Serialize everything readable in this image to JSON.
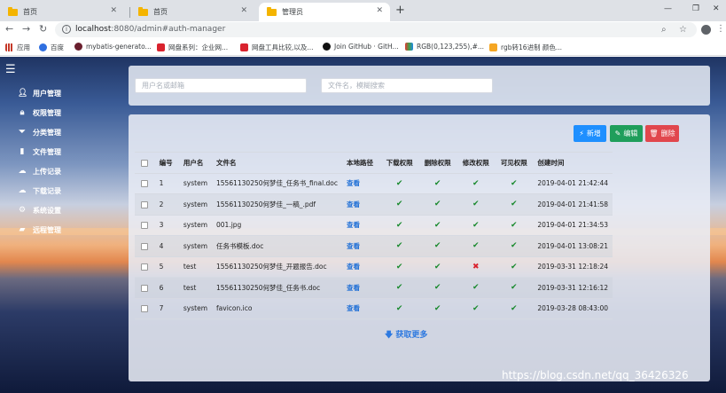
{
  "browser": {
    "tabs": [
      {
        "title": "首页"
      },
      {
        "title": "首页"
      },
      {
        "title": "管理员"
      }
    ],
    "url_host": "localhost",
    "url_path": ":8080/admin#auth-manager",
    "bookmarks": [
      "应用",
      "百度",
      "mybatis-generato...",
      "网盘系列：企业网...",
      "网盘工具比较,以及...",
      "Join GitHub · GitH...",
      "RGB(0,123,255),#...",
      "rgb转16进制 颜色..."
    ],
    "colors": {
      "tabstrip": "#dee1e6"
    }
  },
  "sidebar": {
    "items": [
      {
        "label": "用户管理",
        "icon": "user-icon"
      },
      {
        "label": "权限管理",
        "icon": "lock-icon"
      },
      {
        "label": "分类管理",
        "icon": "filter-icon"
      },
      {
        "label": "文件管理",
        "icon": "file-icon"
      },
      {
        "label": "上传记录",
        "icon": "cloud-upload-icon"
      },
      {
        "label": "下载记录",
        "icon": "cloud-download-icon"
      },
      {
        "label": "系统设置",
        "icon": "gear-icon"
      },
      {
        "label": "远程管理",
        "icon": "folder-icon"
      }
    ]
  },
  "search": {
    "user_placeholder": "用户名或邮箱",
    "file_placeholder": "文件名，模糊搜索"
  },
  "toolbar": {
    "add_label": "新增",
    "edit_label": "编辑",
    "delete_label": "删除",
    "colors": {
      "add": "#1e8fff",
      "edit": "#1f9e5b",
      "delete": "#e1474d"
    }
  },
  "table": {
    "headers": [
      "编号",
      "用户名",
      "文件名",
      "本地路径",
      "下载权限",
      "删除权限",
      "修改权限",
      "可见权限",
      "创建时间"
    ],
    "view_label": "查看",
    "rows": [
      {
        "id": "1",
        "user": "system",
        "file": "15561130250何梦佳_任务书_final.doc",
        "perms": [
          true,
          true,
          true,
          true
        ],
        "time": "2019-04-01 21:42:44"
      },
      {
        "id": "2",
        "user": "system",
        "file": "15561130250何梦佳_一稿_.pdf",
        "perms": [
          true,
          true,
          true,
          true
        ],
        "time": "2019-04-01 21:41:58"
      },
      {
        "id": "3",
        "user": "system",
        "file": "001.jpg",
        "perms": [
          true,
          true,
          true,
          true
        ],
        "time": "2019-04-01 21:34:53"
      },
      {
        "id": "4",
        "user": "system",
        "file": "任务书模板.doc",
        "perms": [
          true,
          true,
          true,
          true
        ],
        "time": "2019-04-01 13:08:21"
      },
      {
        "id": "5",
        "user": "test",
        "file": "15561130250何梦佳_开题报告.doc",
        "perms": [
          true,
          true,
          false,
          true
        ],
        "time": "2019-03-31 12:18:24"
      },
      {
        "id": "6",
        "user": "test",
        "file": "15561130250何梦佳_任务书.doc",
        "perms": [
          true,
          true,
          true,
          true
        ],
        "time": "2019-03-31 12:16:12"
      },
      {
        "id": "7",
        "user": "system",
        "file": "favicon.ico",
        "perms": [
          true,
          true,
          true,
          true
        ],
        "time": "2019-03-28 08:43:00"
      }
    ]
  },
  "load_more": "获取更多",
  "watermark": "https://blog.csdn.net/qq_36426326"
}
